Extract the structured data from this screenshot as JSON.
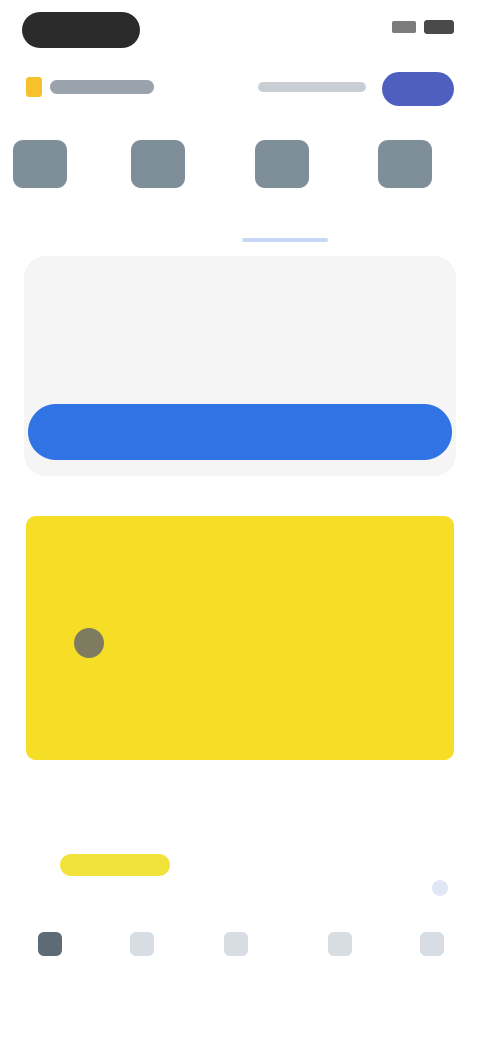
{
  "header": {
    "logo_text": "",
    "link_text": "",
    "button_text": ""
  },
  "categories": [
    {
      "label": "",
      "selected": false
    },
    {
      "label": "",
      "selected": false
    },
    {
      "label": "",
      "selected": true
    },
    {
      "label": "",
      "selected": false
    }
  ],
  "card": {
    "title": "",
    "subtitle": "",
    "cta_label": ""
  },
  "notice": {
    "text": ""
  },
  "bottom": {
    "badge": "",
    "summary": ""
  },
  "nav": [
    {
      "label": "",
      "active": true
    },
    {
      "label": "",
      "active": false
    },
    {
      "label": "",
      "active": false
    },
    {
      "label": "",
      "active": false
    },
    {
      "label": "",
      "active": false
    }
  ],
  "colors": {
    "primary": "#2f73e5",
    "accent_yellow": "#f7de26",
    "header_button": "#4f5fc0"
  }
}
